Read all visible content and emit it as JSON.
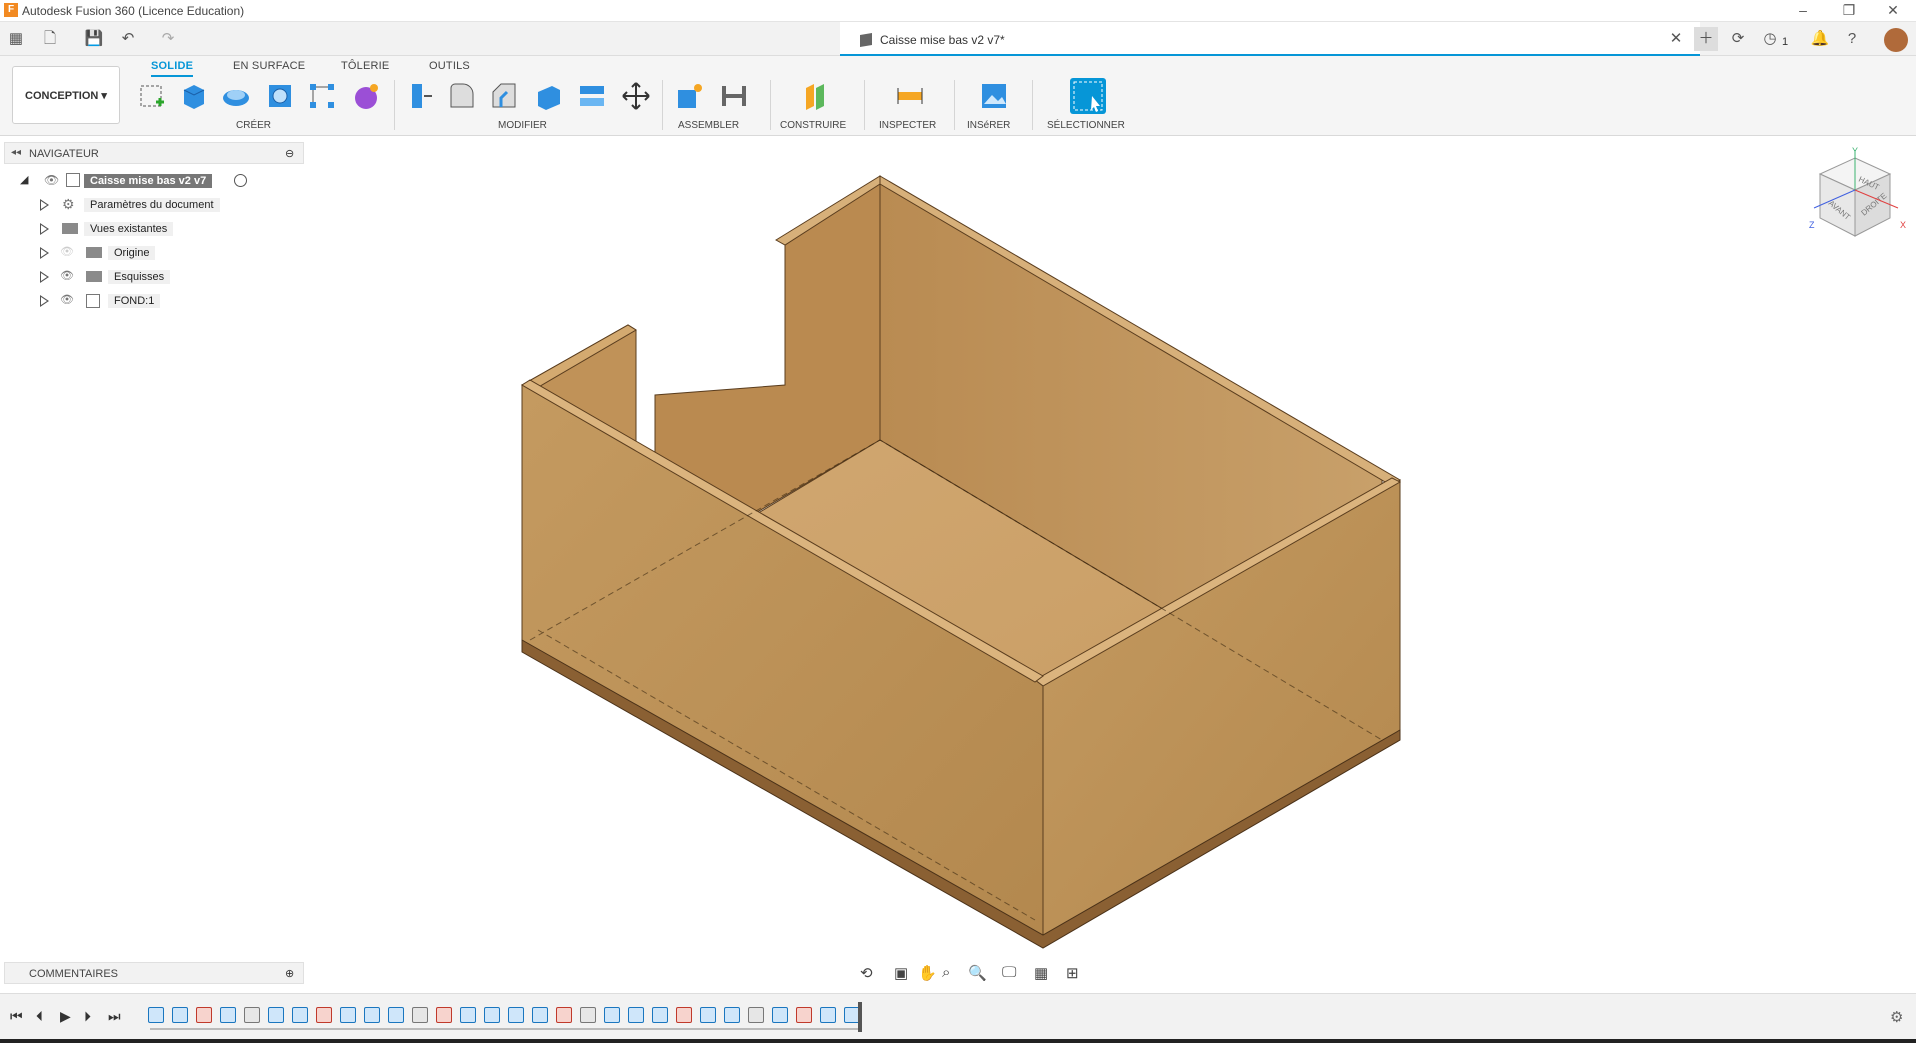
{
  "window": {
    "app_title": "Autodesk Fusion 360 (Licence Education)",
    "doc_title": "Caisse mise bas v2 v7*",
    "job_count": "1"
  },
  "toolbar": {
    "workspace": "CONCEPTION",
    "tabs": [
      {
        "label": "SOLIDE",
        "active": true
      },
      {
        "label": "EN SURFACE",
        "active": false
      },
      {
        "label": "TÔLERIE",
        "active": false
      },
      {
        "label": "OUTILS",
        "active": false
      }
    ],
    "groups": [
      {
        "label": "CRÉER"
      },
      {
        "label": "MODIFIER"
      },
      {
        "label": "ASSEMBLER"
      },
      {
        "label": "CONSTRUIRE"
      },
      {
        "label": "INSPECTER"
      },
      {
        "label": "INSéRER"
      },
      {
        "label": "SÉLECTIONNER"
      }
    ]
  },
  "browser": {
    "title": "NAVIGATEUR",
    "root": "Caisse mise bas v2 v7",
    "items": [
      {
        "label": "Paramètres du document",
        "icon": "gear-icon"
      },
      {
        "label": "Vues existantes",
        "icon": "folder-icon"
      },
      {
        "label": "Origine",
        "icon": "folder-icon"
      },
      {
        "label": "Esquisses",
        "icon": "folder-icon"
      },
      {
        "label": "FOND:1",
        "icon": "component-icon"
      }
    ],
    "comments": "COMMENTAIRES"
  },
  "viewcube": {
    "top": "HAUT",
    "front": "AVANT",
    "right": "DROITE",
    "x": "X",
    "y": "Y",
    "z": "Z"
  },
  "colors": {
    "accent": "#0696d7",
    "wood_light": "#c9a064",
    "wood_mid": "#b8884f",
    "wood_dark": "#a8763f"
  }
}
